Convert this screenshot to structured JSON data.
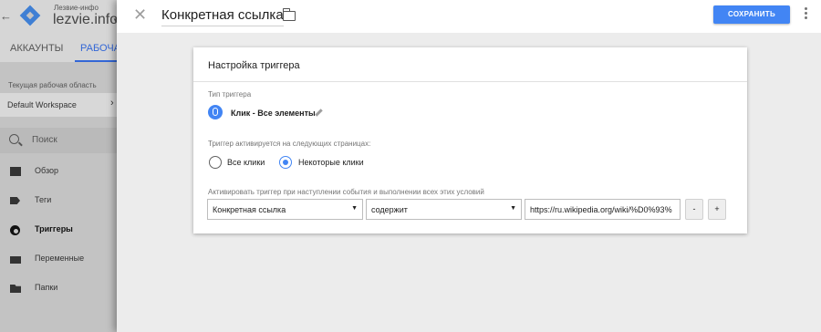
{
  "background_app": {
    "back_glyph": "←",
    "account_subtitle": "Лезвие-инфо",
    "account_name": "lezvie.info",
    "account_caret": "▼",
    "tabs": [
      {
        "label": "АККАУНТЫ"
      },
      {
        "label": "РАБОЧАЯ"
      }
    ],
    "workspace_label": "Текущая рабочая область",
    "workspace_value": "Default Workspace",
    "workspace_arrow": "›",
    "search_placeholder": "Поиск",
    "nav": [
      {
        "label": "Обзор"
      },
      {
        "label": "Теги"
      },
      {
        "label": "Триггеры"
      },
      {
        "label": "Переменные"
      },
      {
        "label": "Папки"
      }
    ]
  },
  "header": {
    "close_glyph": "✕",
    "title": "Конкретная ссылка",
    "save_label": "СОХРАНИТЬ"
  },
  "card": {
    "title": "Настройка триггера",
    "trigger_type_label": "Тип триггера",
    "trigger_type_name": "Клик - Все элементы",
    "fires_on_label": "Триггер активируется на следующих страницах:",
    "radio_options": [
      {
        "label": "Все клики",
        "checked": false
      },
      {
        "label": "Некоторые клики",
        "checked": true
      }
    ],
    "conditions_label": "Активировать триггер при наступлении события и выполнении всех этих условий",
    "condition": {
      "variable": "Конкретная ссылка",
      "operator": "содержит",
      "value": "https://ru.wikipedia.org/wiki/%D0%93%",
      "caret": "▼",
      "remove_label": "-",
      "add_label": "+"
    }
  },
  "colors": {
    "accent": "#4285f4",
    "sheet_background": "#ececec",
    "dimmed_sidebar": "#c3c3c3"
  }
}
